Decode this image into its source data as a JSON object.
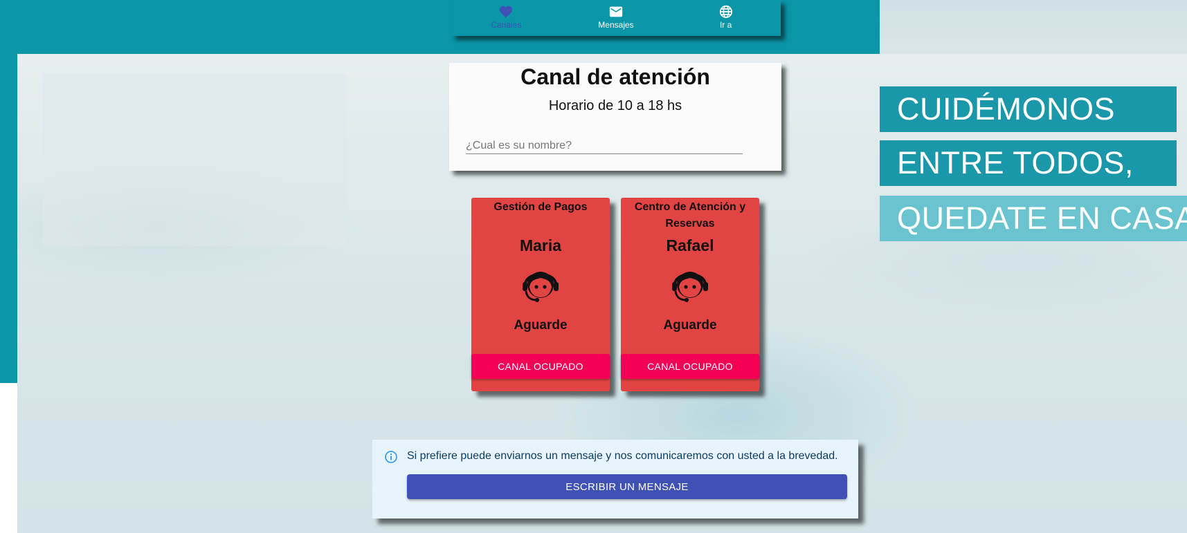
{
  "nav": {
    "items": [
      {
        "label": "Canales",
        "icon": "heart-icon",
        "active": true
      },
      {
        "label": "Mensajes",
        "icon": "mail-icon",
        "active": false
      },
      {
        "label": "Ir a",
        "icon": "globe-icon",
        "active": false
      }
    ]
  },
  "main": {
    "title": "Canal de atención",
    "subtitle": "Horario de 10 a 18 hs",
    "name_placeholder": "¿Cual es su nombre?",
    "name_value": ""
  },
  "agents": [
    {
      "department": "Gestión de Pagos",
      "name": "Maria",
      "icon": "support-agent-icon",
      "status": "Aguarde",
      "button": "CANAL OCUPADO"
    },
    {
      "department": "Centro de Atención y Reservas",
      "name": "Rafael",
      "icon": "support-agent-icon",
      "status": "Aguarde",
      "button": "CANAL OCUPADO"
    }
  ],
  "alert": {
    "icon": "info-icon",
    "text": "Si prefiere puede enviarnos un mensaje y nos comunicaremos con usted a la brevedad.",
    "button": "ESCRIBIR UN MENSAJE"
  },
  "banner": {
    "lines": [
      "CUIDÉMONOS",
      "ENTRE TODOS,",
      "QUEDATE EN CASA"
    ]
  },
  "colors": {
    "teal": "#0b96a8",
    "card_red": "#e24444",
    "busy_pink": "#f50057",
    "primary_indigo": "#3f51b5",
    "alert_bg": "#e8f4fd"
  }
}
